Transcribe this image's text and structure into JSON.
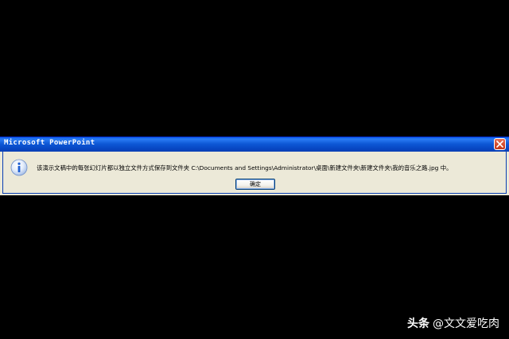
{
  "dialog": {
    "title": "Microsoft PowerPoint",
    "message": "该演示文稿中的每张幻灯片都以独立文件方式保存到文件夹 C:\\Documents and Settings\\Administrator\\桌面\\新建文件夹\\新建文件夹\\我的音乐之路.jpg 中。",
    "ok_label": "确定",
    "icon": "info-icon",
    "close_icon": "close-icon"
  },
  "watermark": {
    "brand": "头条",
    "handle": "@文文爱吃肉"
  },
  "colors": {
    "background": "#000000",
    "titlebar": "#0e58d6",
    "dialog_face": "#ece9d8",
    "close_button": "#d24a2c",
    "info_icon": "#1f5fd1"
  }
}
